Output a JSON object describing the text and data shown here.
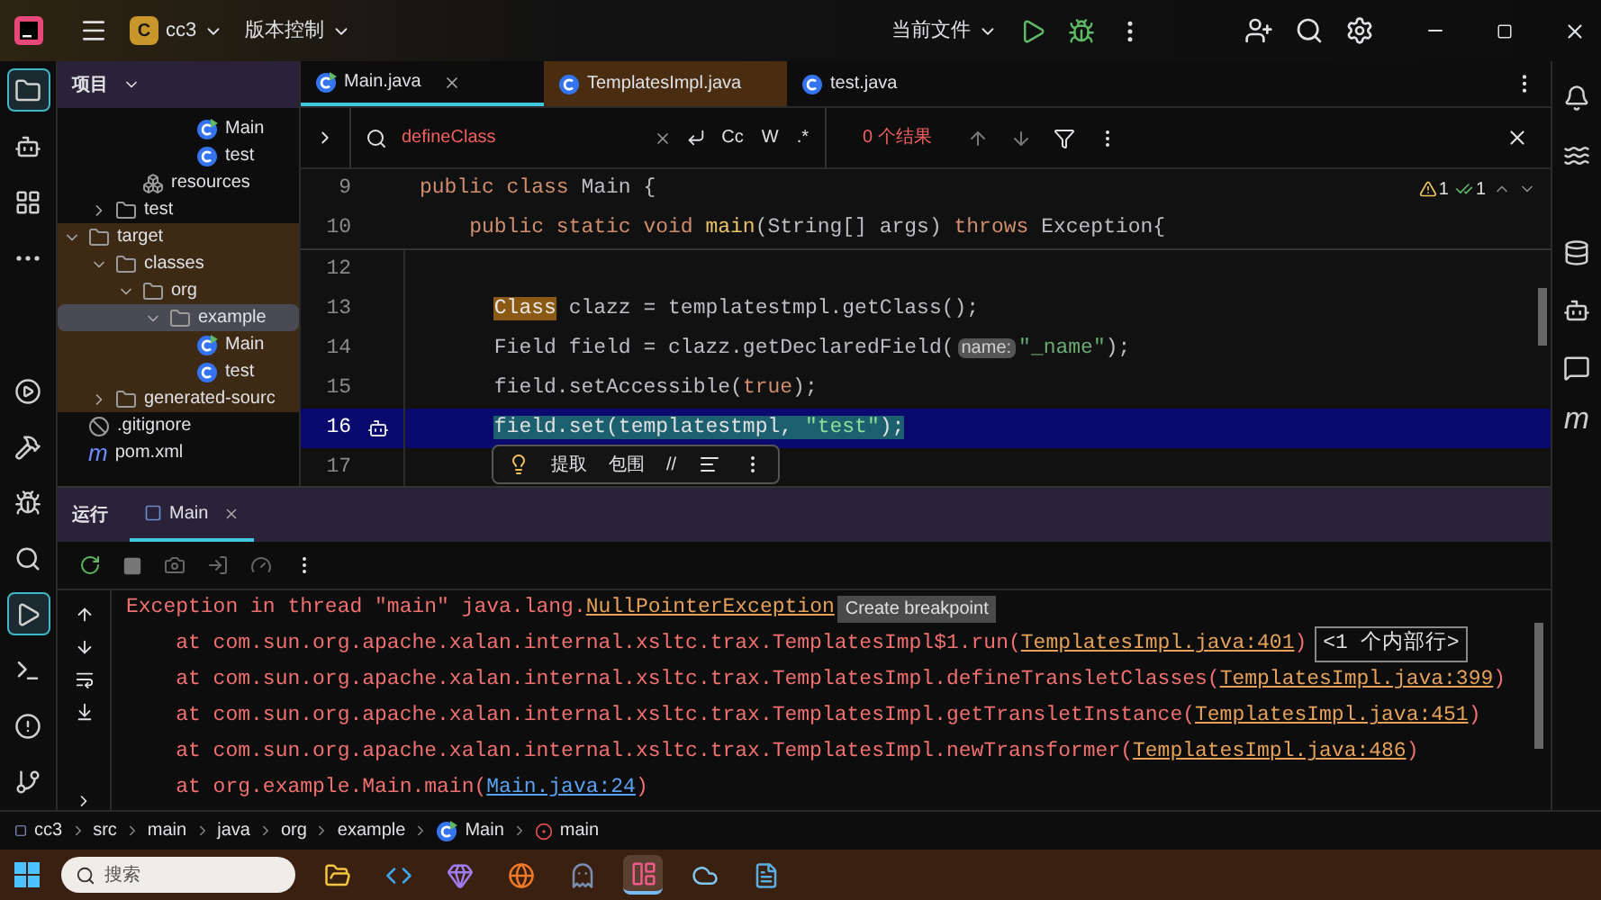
{
  "title_bar": {
    "project_badge": "C",
    "project": "cc3",
    "vcs": "版本控制",
    "run_config": "当前文件"
  },
  "left_tools": [
    {
      "kind": "folder",
      "selected": true
    },
    {
      "kind": "ai",
      "selected": false
    },
    {
      "kind": "structure",
      "selected": false
    },
    {
      "kind": "more",
      "selected": false
    },
    {
      "kind": "services",
      "selected": false
    },
    {
      "kind": "build",
      "selected": false
    },
    {
      "kind": "debug",
      "selected": false
    },
    {
      "kind": "search",
      "selected": false
    },
    {
      "kind": "run",
      "selected": true
    },
    {
      "kind": "terminal",
      "selected": false
    },
    {
      "kind": "problems",
      "selected": false
    },
    {
      "kind": "git",
      "selected": false
    }
  ],
  "right_tools": [
    {
      "kind": "bell"
    },
    {
      "kind": "swirl"
    },
    {
      "kind": "database"
    },
    {
      "kind": "ai"
    },
    {
      "kind": "ai-chat"
    },
    {
      "kind": "glyph",
      "glyph": "m"
    }
  ],
  "project_panel": {
    "title": "项目",
    "tree": [
      {
        "children": [
          {
            "children": [
              {
                "children": [
                  {
                    "children": [
                      {
                        "label": "Main",
                        "kind": "run-class"
                      },
                      {
                        "label": "test",
                        "kind": "class"
                      }
                    ]
                  }
                ]
              },
              {
                "label": "resources",
                "kind": "resources"
              }
            ]
          },
          {
            "label": "test",
            "kind": "folder",
            "expanded": false
          }
        ]
      },
      {
        "label": "target",
        "kind": "folder",
        "expanded": true,
        "excluded": true,
        "children": [
          {
            "label": "classes",
            "kind": "folder",
            "expanded": true,
            "children": [
              {
                "label": "org",
                "kind": "folder",
                "expanded": true,
                "children": [
                  {
                    "label": "example",
                    "kind": "folder",
                    "expanded": true,
                    "selected": true,
                    "children": [
                      {
                        "label": "Main",
                        "kind": "run-class"
                      },
                      {
                        "label": "test",
                        "kind": "class"
                      }
                    ]
                  }
                ]
              }
            ]
          },
          {
            "label": "generated-sourc",
            "kind": "folder",
            "expanded": false
          }
        ]
      },
      {
        "label": ".gitignore",
        "kind": "ignore"
      },
      {
        "label": "pom.xml",
        "kind": "glyph",
        "glyph": "m"
      }
    ]
  },
  "editor": {
    "tabs": [
      {
        "label": "Main.java",
        "kind": "run-class",
        "selected": true,
        "excluded": false
      },
      {
        "label": "TemplatesImpl.java",
        "kind": "class",
        "selected": false,
        "excluded": true
      },
      {
        "label": "test.java",
        "kind": "class",
        "selected": false,
        "excluded": false
      }
    ],
    "search": {
      "value": "defineClass",
      "options": [
        "Cc",
        "W",
        ".*"
      ],
      "results": "0 个结果"
    },
    "inspections": [
      {
        "kind": "warning",
        "count": "1"
      },
      {
        "kind": "ok",
        "count": "1"
      }
    ],
    "sticky_lines": [
      {
        "number": "9",
        "tokens": [
          {
            "text": "public class ",
            "kind": "keyword"
          },
          {
            "text": "Main {",
            "kind": "plain"
          }
        ]
      },
      {
        "number": "10",
        "tokens": [
          {
            "text": "public static void ",
            "kind": "keyword"
          },
          {
            "text": "main",
            "kind": "method"
          },
          {
            "text": "(String[] args) ",
            "kind": "plain"
          },
          {
            "text": "throws ",
            "kind": "keyword"
          },
          {
            "text": "Exception{",
            "kind": "plain"
          }
        ]
      }
    ],
    "lines": [
      {
        "number": "12",
        "selected": false,
        "gutter_mark": false
      },
      {
        "number": "13",
        "selected": false,
        "gutter_mark": false,
        "tokens": [
          {
            "text": "Class",
            "kind": "match"
          },
          {
            "text": " clazz = templatestmpl.getClass();",
            "kind": "plain"
          }
        ]
      },
      {
        "number": "14",
        "selected": false,
        "gutter_mark": false,
        "tokens": [
          {
            "text": "Field field = clazz.getDeclaredField(",
            "kind": "plain"
          },
          {
            "text": "name:",
            "kind": "hint"
          },
          {
            "text": "\"_name\"",
            "kind": "string"
          },
          {
            "text": ");",
            "kind": "plain"
          }
        ]
      },
      {
        "number": "15",
        "selected": false,
        "gutter_mark": false,
        "tokens": [
          {
            "text": "field.setAccessible(",
            "kind": "plain"
          },
          {
            "text": "true",
            "kind": "keyword"
          },
          {
            "text": ");",
            "kind": "plain"
          }
        ]
      },
      {
        "number": "16",
        "selected": true,
        "gutter_mark": true,
        "tokens": [
          {
            "text": "field.set(templatestmpl, ",
            "kind": "selection"
          },
          {
            "text": "\"test\"",
            "kind": "selection-string"
          },
          {
            "text": ");",
            "kind": "selection"
          }
        ]
      },
      {
        "number": "17",
        "selected": false,
        "gutter_mark": false
      }
    ],
    "popup": {
      "actions": [
        "提取",
        "包围",
        "//"
      ]
    }
  },
  "run_panel": {
    "title": "运行",
    "tabs": [
      {
        "label": "Main",
        "selected": true
      }
    ],
    "console": [
      {
        "tokens": [
          {
            "text": "Exception in thread \"main\" java.lang.",
            "kind": "error"
          },
          {
            "text": "NullPointerException",
            "kind": "lib-link"
          },
          {
            "text": "Create breakpoint",
            "kind": "badge"
          }
        ]
      },
      {
        "tokens": [
          {
            "text": "    at com.sun.org.apache.xalan.internal.xsltc.trax.TemplatesImpl$1.run(",
            "kind": "error"
          },
          {
            "text": "TemplatesImpl.java:401",
            "kind": "lib-link"
          },
          {
            "text": ")",
            "kind": "error"
          },
          {
            "text": "<1 个内部行>",
            "kind": "fold"
          }
        ]
      },
      {
        "tokens": [
          {
            "text": "    at com.sun.org.apache.xalan.internal.xsltc.trax.TemplatesImpl.defineTransletClasses(",
            "kind": "error"
          },
          {
            "text": "TemplatesImpl.java:399",
            "kind": "lib-link"
          },
          {
            "text": ")",
            "kind": "error"
          }
        ]
      },
      {
        "tokens": [
          {
            "text": "    at com.sun.org.apache.xalan.internal.xsltc.trax.TemplatesImpl.getTransletInstance(",
            "kind": "error"
          },
          {
            "text": "TemplatesImpl.java:451",
            "kind": "lib-link"
          },
          {
            "text": ")",
            "kind": "error"
          }
        ]
      },
      {
        "tokens": [
          {
            "text": "    at com.sun.org.apache.xalan.internal.xsltc.trax.TemplatesImpl.newTransformer(",
            "kind": "error"
          },
          {
            "text": "TemplatesImpl.java:486",
            "kind": "lib-link"
          },
          {
            "text": ")",
            "kind": "error"
          }
        ]
      },
      {
        "tokens": [
          {
            "text": "    at org.example.Main.main(",
            "kind": "error"
          },
          {
            "text": "Main.java:24",
            "kind": "src-link"
          },
          {
            "text": ")",
            "kind": "error"
          }
        ]
      }
    ]
  },
  "breadcrumbs": [
    {
      "label": "cc3",
      "kind": "module"
    },
    {
      "label": "src",
      "kind": "folder"
    },
    {
      "label": "main",
      "kind": "folder"
    },
    {
      "label": "java",
      "kind": "folder"
    },
    {
      "label": "org",
      "kind": "folder"
    },
    {
      "label": "example",
      "kind": "folder"
    },
    {
      "label": "Main",
      "kind": "run-class"
    },
    {
      "label": "main",
      "kind": "method"
    }
  ],
  "taskbar": {
    "search_placeholder": "搜索",
    "apps": [
      {
        "kind": "files",
        "active": false
      },
      {
        "kind": "code",
        "active": false
      },
      {
        "kind": "gem",
        "active": false
      },
      {
        "kind": "browser",
        "active": false
      },
      {
        "kind": "ghost",
        "active": false
      },
      {
        "kind": "ide",
        "active": true
      },
      {
        "kind": "cloud",
        "active": false
      },
      {
        "kind": "notes",
        "active": false
      }
    ]
  }
}
